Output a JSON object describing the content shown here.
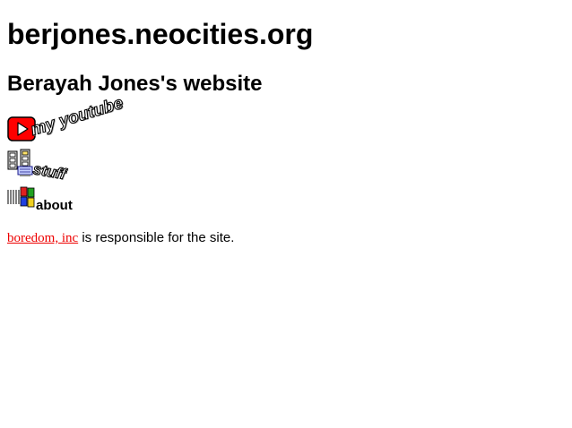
{
  "header": {
    "site_title": "berjones.neocities.org",
    "subtitle": "Berayah Jones's website"
  },
  "nav": {
    "youtube_label": "my youtube",
    "stuff_label": "stuff",
    "about_label": "about"
  },
  "footer": {
    "company_link": "boredom, inc",
    "responsible_text": " is responsible for the site."
  },
  "colors": {
    "link": "#ee0000",
    "youtube_red": "#ff0000",
    "text": "#000000",
    "background": "#ffffff"
  },
  "icons": {
    "youtube": "youtube-play-icon",
    "stuff": "film-reel-computer-icon",
    "about": "windows-flag-icon"
  }
}
